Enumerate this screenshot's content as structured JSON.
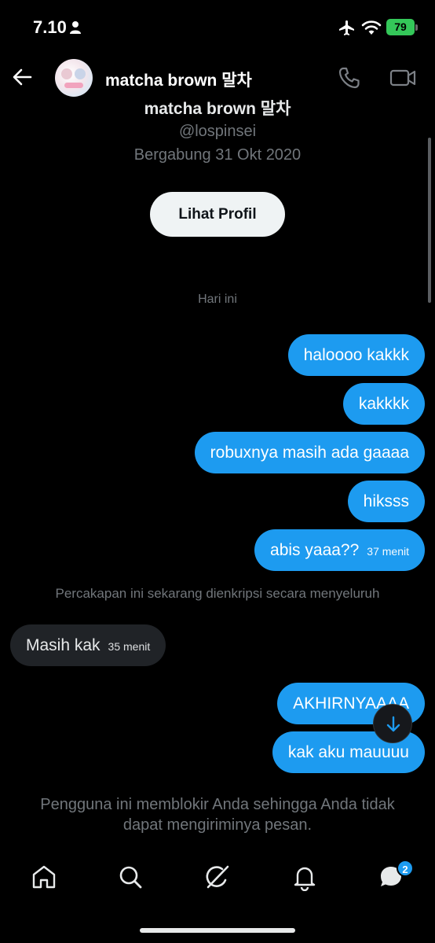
{
  "status_bar": {
    "time": "7.10",
    "battery": "79",
    "icons": [
      "person-icon",
      "airplane-icon",
      "wifi-icon",
      "battery-icon"
    ]
  },
  "header": {
    "name": "matcha brown 말차",
    "icons": [
      "back-arrow-icon",
      "phone-icon",
      "video-call-icon"
    ]
  },
  "profile": {
    "name": "matcha brown 말차",
    "handle": "@lospinsei",
    "joined": "Bergabung 31 Okt 2020",
    "button_label": "Lihat Profil"
  },
  "conversation": {
    "day_label": "Hari ini",
    "messages": [
      {
        "direction": "out",
        "text": "haloooo kakkk",
        "time": ""
      },
      {
        "direction": "out",
        "text": "kakkkk",
        "time": ""
      },
      {
        "direction": "out",
        "text": "robuxnya masih ada gaaaa",
        "time": ""
      },
      {
        "direction": "out",
        "text": "hiksss",
        "time": ""
      },
      {
        "direction": "out",
        "text": "abis yaaa??",
        "time": "37 menit"
      },
      {
        "direction": "in",
        "text": "Masih kak",
        "time": "35 menit"
      },
      {
        "direction": "out",
        "text": "AKHIRNYAAAA",
        "time": ""
      },
      {
        "direction": "out",
        "text": "kak aku mauuuu",
        "time": ""
      }
    ],
    "encryption_note": "Percakapan ini sekarang dienkripsi secara menyeluruh",
    "blocked_note": "Pengguna ini memblokir Anda sehingga Anda tidak dapat mengiriminya pesan."
  },
  "bottom_nav": {
    "items": [
      "home-icon",
      "search-icon",
      "grok-icon",
      "notifications-icon",
      "messages-icon"
    ],
    "messages_badge": "2"
  },
  "colors": {
    "accent": "#1d9bf0",
    "background": "#000000",
    "incoming_bubble": "#202327",
    "muted_text": "#71767b",
    "battery": "#34c759"
  }
}
